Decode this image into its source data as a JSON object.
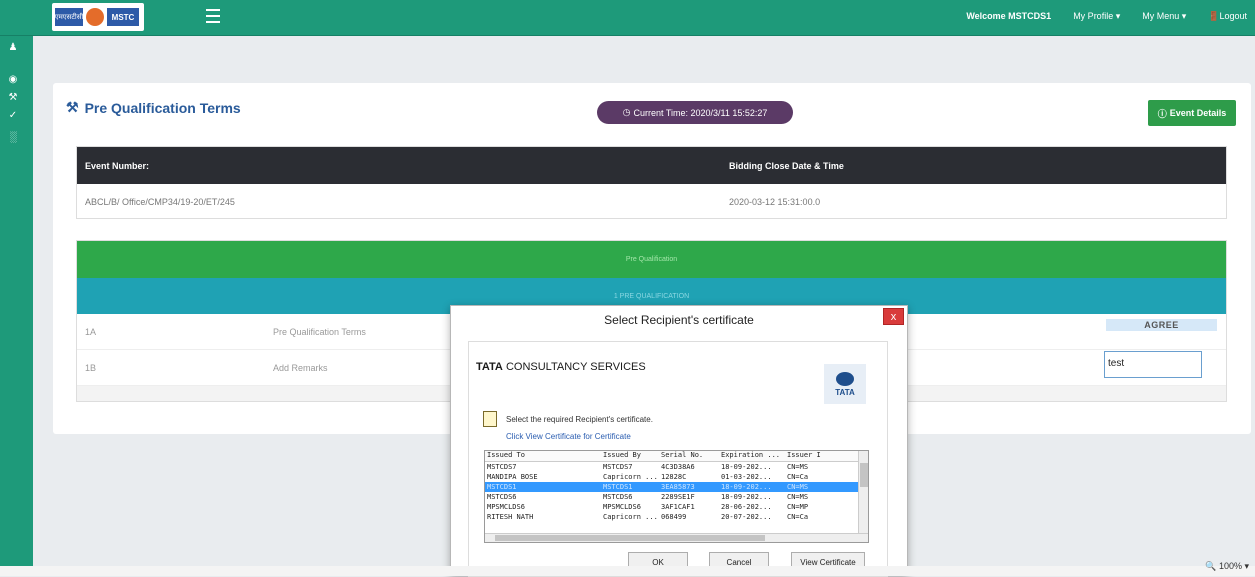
{
  "header": {
    "logo_text_left": "एमएसटीसी",
    "logo_text_right": "MSTC",
    "welcome": "Welcome MSTCDS1",
    "my_profile": "My Profile ▾",
    "my_menu": "My Menu ▾",
    "logout": "Logout"
  },
  "page": {
    "title": "Pre Qualification Terms",
    "current_time": "Current Time: 2020/3/11 15:52:27",
    "event_details_button": "Event Details"
  },
  "event_table": {
    "col_event_number": "Event Number:",
    "col_bidding_close": "Bidding Close Date & Time",
    "event_number": "ABCL/B/ Office/CMP34/19-20/ET/245",
    "bidding_close": "2020-03-12 15:31:00.0"
  },
  "terms_table": {
    "green_header": "Pre Qualification",
    "teal_header": "1 PRE QUALIFICATION",
    "rows": [
      {
        "no": "1A",
        "desc": "Pre Qualification Terms",
        "action": "AGREE"
      },
      {
        "no": "1B",
        "desc": "Add Remarks",
        "action": "test"
      }
    ]
  },
  "dialog": {
    "title": "Select Recipient's certificate",
    "close": "x",
    "tcs_brand": "TATA",
    "tcs_rest": " CONSULTANCY SERVICES",
    "tata_logo_text": "TATA",
    "instruction_1": "Select the required Recipient's certificate.",
    "instruction_2": "Click View Certificate for Certificate",
    "columns": [
      "Issued To",
      "Issued By",
      "Serial No.",
      "Expiration ...",
      "Issuer I"
    ],
    "certs": [
      {
        "to": "MSTCDS7",
        "by": "MSTCDS7",
        "serial": "4C3D38A6",
        "exp": "18-09-202...",
        "issuer": "CN=MS"
      },
      {
        "to": "MANDIPA BOSE",
        "by": "Capricorn ...",
        "serial": "12828C",
        "exp": "01-03-202...",
        "issuer": "CN=Ca"
      },
      {
        "to": "MSTCDS1",
        "by": "MSTCDS1",
        "serial": "3EA85873",
        "exp": "18-09-202...",
        "issuer": "CN=MS",
        "selected": true
      },
      {
        "to": "MSTCDS6",
        "by": "MSTCDS6",
        "serial": "2289SE1F",
        "exp": "18-09-202...",
        "issuer": "CN=MS"
      },
      {
        "to": "MPSMCLDS6",
        "by": "MPSMCLDS6",
        "serial": "3AF1CAF1",
        "exp": "28-06-202...",
        "issuer": "CN=MP"
      },
      {
        "to": "RITESH NATH",
        "by": "Capricorn ...",
        "serial": "068499",
        "exp": "20-07-202...",
        "issuer": "CN=Ca"
      }
    ],
    "ok": "OK",
    "cancel": "Cancel",
    "view_certificate": "View Certificate"
  },
  "statusbar": {
    "zoom": "100%"
  }
}
